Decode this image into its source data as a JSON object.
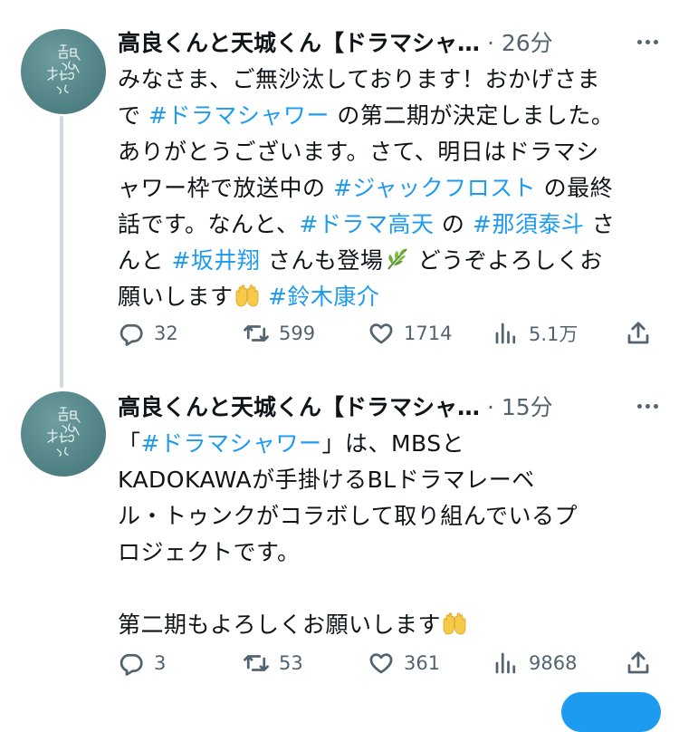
{
  "tweets": [
    {
      "author": "高良くんと天城くん【ドラマシャ…",
      "separator": "·",
      "time": "26分",
      "lines": [
        [
          {
            "t": "みなさま、ご無沙汰しております！おかげさま"
          }
        ],
        [
          {
            "t": "で "
          },
          {
            "t": "#ドラマシャワー",
            "tag": true
          },
          {
            "t": " の第二期が決定しました。"
          }
        ],
        [
          {
            "t": "ありがとうございます。さて、明日はドラマシ"
          }
        ],
        [
          {
            "t": "ャワー枠で放送中の "
          },
          {
            "t": "#ジャックフロスト",
            "tag": true
          },
          {
            "t": " の最終"
          }
        ],
        [
          {
            "t": "話です。なんと、"
          },
          {
            "t": "#ドラマ高天",
            "tag": true
          },
          {
            "t": " の "
          },
          {
            "t": "#那須泰斗",
            "tag": true
          },
          {
            "t": " さ"
          }
        ],
        [
          {
            "t": "んと "
          },
          {
            "t": "#坂井翔",
            "tag": true
          },
          {
            "t": " さんも登場"
          },
          {
            "emoji": "herb"
          },
          {
            "t": " どうぞよろしくお"
          }
        ],
        [
          {
            "t": "願いします"
          },
          {
            "emoji": "hands"
          },
          {
            "t": " "
          },
          {
            "t": "#鈴木康介",
            "tag": true
          }
        ]
      ],
      "stats": {
        "replies": "32",
        "retweets": "599",
        "likes": "1714",
        "views": "5.1万"
      }
    },
    {
      "author": "高良くんと天城くん【ドラマシャ…",
      "separator": "·",
      "time": "15分",
      "lines": [
        [
          {
            "t": "「"
          },
          {
            "t": "#ドラマシャワー",
            "tag": true
          },
          {
            "t": "」は、MBSと"
          }
        ],
        [
          {
            "t": "KADOKAWAが手掛けるBLドラマレーベ"
          }
        ],
        [
          {
            "t": "ル・トゥンクがコラボして取り組んでいるプ"
          }
        ],
        [
          {
            "t": "ロジェクトです。"
          }
        ],
        [
          {
            "t": ""
          }
        ],
        [
          {
            "t": "第二期もよろしくお願いします"
          },
          {
            "emoji": "hands"
          }
        ]
      ],
      "stats": {
        "replies": "3",
        "retweets": "53",
        "likes": "361",
        "views": "9868"
      }
    }
  ],
  "icons": {
    "reply": "reply-icon",
    "retweet": "retweet-icon",
    "like": "heart-icon",
    "views": "views-icon",
    "share": "share-icon",
    "more": "more-icon",
    "emoji_herb": "herb-emoji-icon",
    "emoji_hands": "raising-hands-emoji-icon"
  },
  "colors": {
    "accent": "#1d9bf0",
    "text": "#0f1419",
    "muted": "#536471",
    "avatar": "#5b8a8c"
  }
}
